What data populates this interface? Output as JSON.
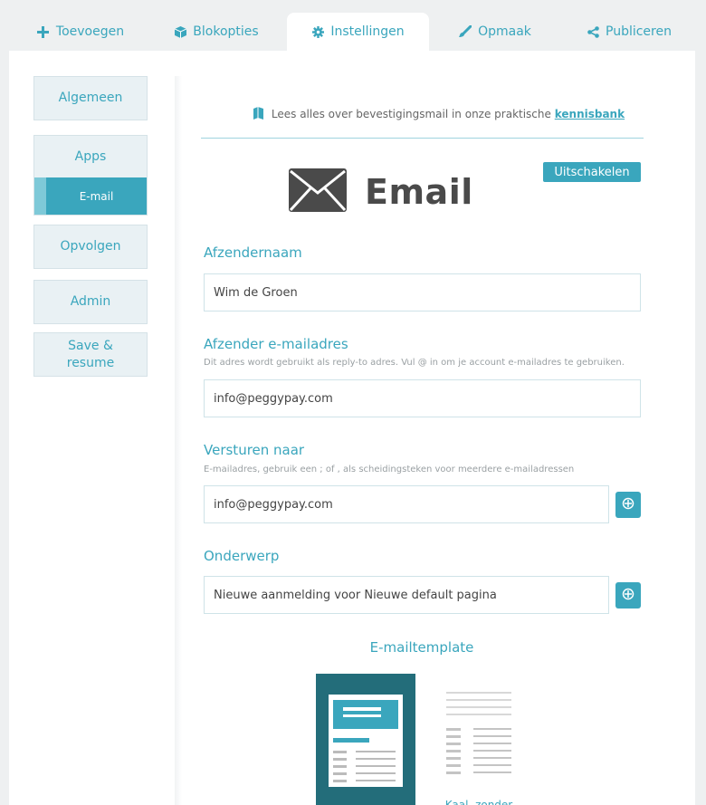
{
  "tabs": [
    {
      "label": "Toevoegen",
      "icon": "plus-icon"
    },
    {
      "label": "Blokopties",
      "icon": "cube-icon"
    },
    {
      "label": "Instellingen",
      "icon": "gear-icon",
      "active": true
    },
    {
      "label": "Opmaak",
      "icon": "brush-icon"
    },
    {
      "label": "Publiceren",
      "icon": "share-icon"
    }
  ],
  "sidebar": {
    "algemeen": "Algemeen",
    "apps": "Apps",
    "email": "E-mail",
    "opvolgen": "Opvolgen",
    "admin": "Admin",
    "save_resume": "Save & resume"
  },
  "info": {
    "text": "Lees alles over bevestigingsmail in onze praktische",
    "link": "kennisbank",
    "icon": "book-icon"
  },
  "email": {
    "title": "Email",
    "icon": "envelope-icon",
    "disable_button": "Uitschakelen"
  },
  "fields": {
    "sender_name": {
      "label": "Afzendernaam",
      "value": "Wim de Groen"
    },
    "sender_email": {
      "label": "Afzender e-mailadres",
      "hint": "Dit adres wordt gebruikt als reply-to adres. Vul @ in om je account e-mailadres te gebruiken.",
      "value": "info@peggypay.com"
    },
    "send_to": {
      "label": "Versturen naar",
      "hint": "E-mailadres, gebruik een ; of , als scheidingsteken voor meerdere e-mailadressen",
      "value": "info@peggypay.com"
    },
    "subject": {
      "label": "Onderwerp",
      "value": "Nieuwe aanmelding voor Nieuwe default pagina"
    }
  },
  "template": {
    "title": "E-mailtemplate",
    "alt_label": "Kaal, zonder"
  },
  "colors": {
    "accent": "#3aa6bd",
    "template_selected": "#236d7a"
  }
}
